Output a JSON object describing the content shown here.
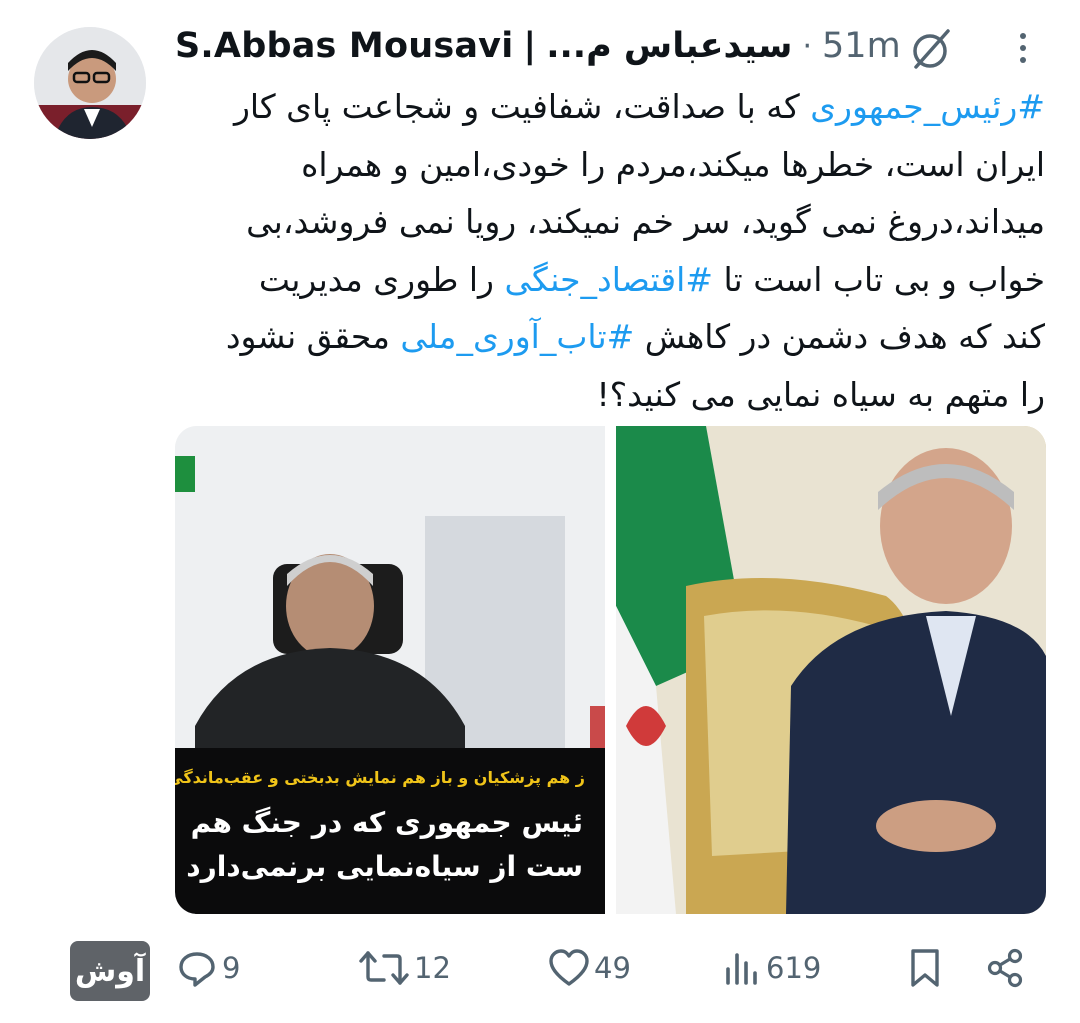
{
  "tweet": {
    "author_name": "S.Abbas Mousavi",
    "separator": "|",
    "author_alt": "سیدعباس م...",
    "time": "51m",
    "text_lines": [
      [
        {
          "text": "#رئیس_جمهوری",
          "tag": true
        },
        {
          "text": " که با صداقت، شفافیت و شجاعت پای کار",
          "tag": false
        }
      ],
      [
        {
          "text": "ایران است، خطرها میکند،مردم را خودی،امین و همراه",
          "tag": false
        }
      ],
      [
        {
          "text": "میداند،دروغ نمی گوید، سر خم نمیکند، رویا نمی فروشد،بی",
          "tag": false
        }
      ],
      [
        {
          "text": "خواب و بی تاب است تا ",
          "tag": false
        },
        {
          "text": "#اقتصاد_جنگی",
          "tag": true
        },
        {
          "text": " را طوری مدیریت",
          "tag": false
        }
      ],
      [
        {
          "text": "کند که هدف دشمن در کاهش ",
          "tag": false
        },
        {
          "text": "#تاب_آوری_ملی",
          "tag": true
        },
        {
          "text": " محقق نشود",
          "tag": false
        }
      ],
      [
        {
          "text": "را متهم به سیاه نمایی می کنید؟!",
          "tag": false
        }
      ]
    ]
  },
  "media": {
    "left_caption_yellow": "ز هم پزشکیان و باز هم نمایش بدبختی و عقب‌ماندگی",
    "left_caption_line1": "ئیس جمهوری که در جنگ هم",
    "left_caption_line2": "ست از سیاه‌نمایی برنمی‌دارد"
  },
  "actions": {
    "badge": "آوش",
    "replies": "9",
    "retweets": "12",
    "likes": "49",
    "views": "619"
  },
  "icons": [
    "grok-icon",
    "more-icon",
    "reply-icon",
    "retweet-icon",
    "like-icon",
    "views-icon",
    "bookmark-icon",
    "share-icon"
  ],
  "colors": {
    "hashtag": "#1d9bf0",
    "muted": "#536471",
    "text": "#0f1419",
    "caption_yellow": "#f0c419"
  }
}
